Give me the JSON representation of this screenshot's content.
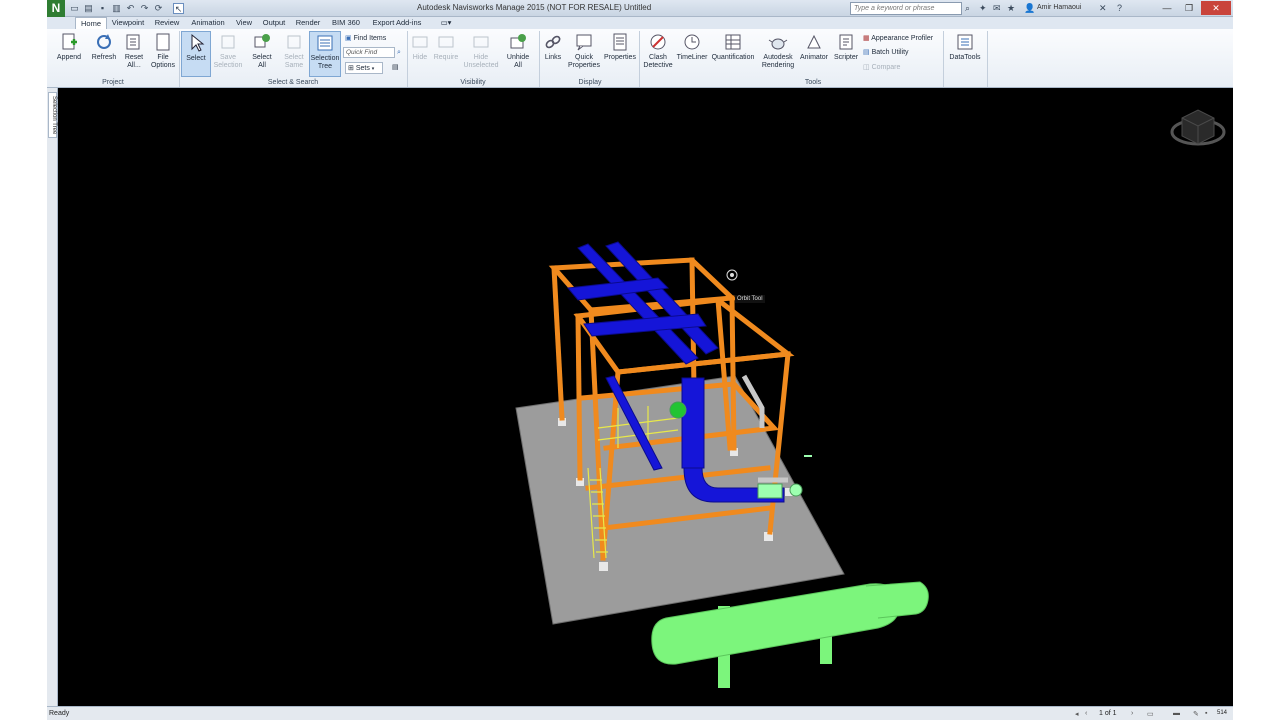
{
  "window": {
    "title": "Autodesk Navisworks Manage 2015 (NOT FOR RESALE)    Untitled",
    "app_logo": "N",
    "search_placeholder": "Type a keyword or phrase",
    "user": "Amir Hamaoui"
  },
  "tabs": [
    "Home",
    "Viewpoint",
    "Review",
    "Animation",
    "View",
    "Output",
    "Render",
    "BIM 360",
    "Export Add-ins"
  ],
  "ribbon": {
    "project": {
      "label": "Project",
      "append": "Append",
      "refresh": "Refresh",
      "reset_all_1": "Reset",
      "reset_all_2": "All...",
      "file_options_1": "File",
      "file_options_2": "Options"
    },
    "select_search": {
      "label": "Select & Search",
      "select": "Select",
      "save_selection_1": "Save",
      "save_selection_2": "Selection",
      "select_all_1": "Select",
      "select_all_2": "All",
      "select_same_1": "Select",
      "select_same_2": "Same",
      "selection_tree_1": "Selection",
      "selection_tree_2": "Tree",
      "find_items": "Find Items",
      "quick_find_placeholder": "Quick Find",
      "sets": "Sets"
    },
    "visibility": {
      "label": "Visibility",
      "hide": "Hide",
      "require": "Require",
      "hide_unselected_1": "Hide",
      "hide_unselected_2": "Unselected",
      "unhide_all_1": "Unhide",
      "unhide_all_2": "All"
    },
    "display": {
      "label": "Display",
      "links": "Links",
      "quick_properties_1": "Quick",
      "quick_properties_2": "Properties",
      "properties": "Properties"
    },
    "tools": {
      "label": "Tools",
      "clash_detective_1": "Clash",
      "clash_detective_2": "Detective",
      "timeliner": "TimeLiner",
      "quantification": "Quantification",
      "autodesk_rendering_1": "Autodesk",
      "autodesk_rendering_2": "Rendering",
      "animator": "Animator",
      "scripter": "Scripter",
      "appearance_profiler": "Appearance Profiler",
      "batch_utility": "Batch Utility",
      "compare": "Compare"
    },
    "datatools": "DataTools"
  },
  "side_panel": {
    "selection_tree_tab": "Selection Tree"
  },
  "viewport": {
    "tooltip": "Orbit Tool"
  },
  "status": {
    "text": "Ready",
    "page": "1 of 1",
    "memory": "514"
  },
  "colors": {
    "steel": "#f08a1e",
    "ducts": "#1515d8",
    "vessel": "#7cf57c",
    "slab": "#9c9c9c",
    "equipment": "#9dffb0"
  }
}
